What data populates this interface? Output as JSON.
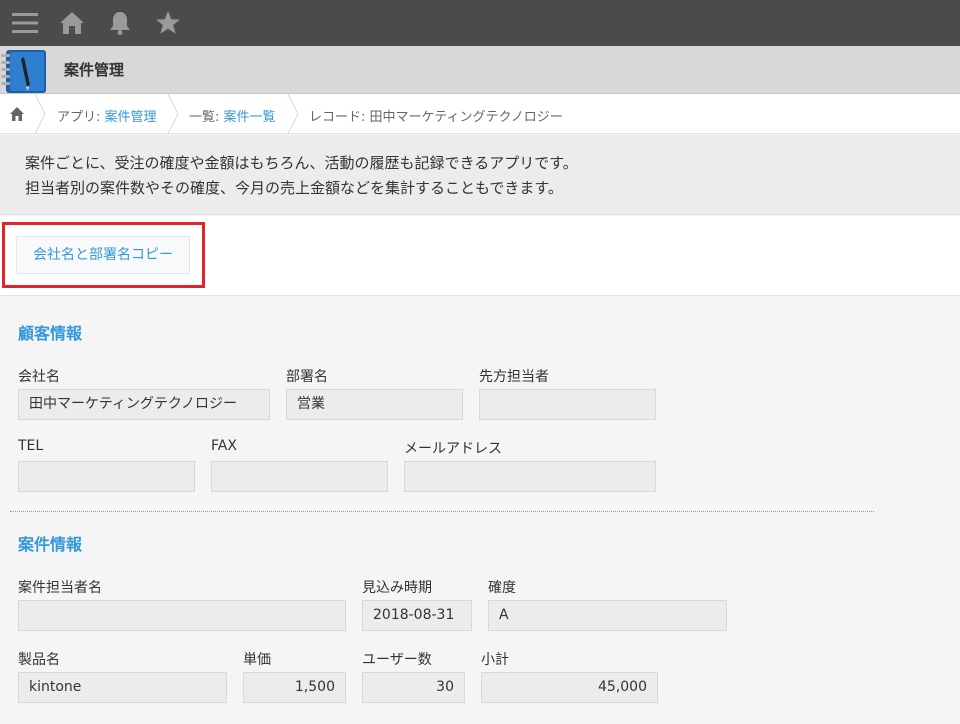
{
  "header": {
    "app_title": "案件管理"
  },
  "breadcrumb": {
    "app_prefix": "アプリ: ",
    "app_link": "案件管理",
    "list_prefix": "一覧: ",
    "list_link": "案件一覧",
    "record_text": "レコード: 田中マーケティングテクノロジー"
  },
  "description": {
    "line1": "案件ごとに、受注の確度や金額はもちろん、活動の履歴も記録できるアプリです。",
    "line2": "担当者別の案件数やその確度、今月の売上金額などを集計することもできます。"
  },
  "toolbar": {
    "copy_button_label": "会社名と部署名コピー"
  },
  "customer_section": {
    "title": "顧客情報",
    "company_label": "会社名",
    "company_value": "田中マーケティングテクノロジー",
    "department_label": "部署名",
    "department_value": "営業",
    "contact_label": "先方担当者",
    "contact_value": "",
    "tel_label": "TEL",
    "tel_value": "",
    "fax_label": "FAX",
    "fax_value": "",
    "email_label": "メールアドレス",
    "email_value": ""
  },
  "deal_section": {
    "title": "案件情報",
    "owner_label": "案件担当者名",
    "owner_value": "",
    "forecast_label": "見込み時期",
    "forecast_value": "2018-08-31",
    "probability_label": "確度",
    "probability_value": "A",
    "product_label": "製品名",
    "product_value": "kintone",
    "unit_price_label": "単価",
    "unit_price_value": "1,500",
    "users_label": "ユーザー数",
    "users_value": "30",
    "subtotal_label": "小計",
    "subtotal_value": "45,000"
  },
  "icons": {
    "menu": "menu-icon",
    "home": "home-icon",
    "notification": "bell-icon",
    "favorite": "star-icon",
    "app": "notebook-icon"
  },
  "colors": {
    "accent": "#3498db",
    "topbar": "#4b4b4b",
    "highlight": "#e3242b"
  }
}
